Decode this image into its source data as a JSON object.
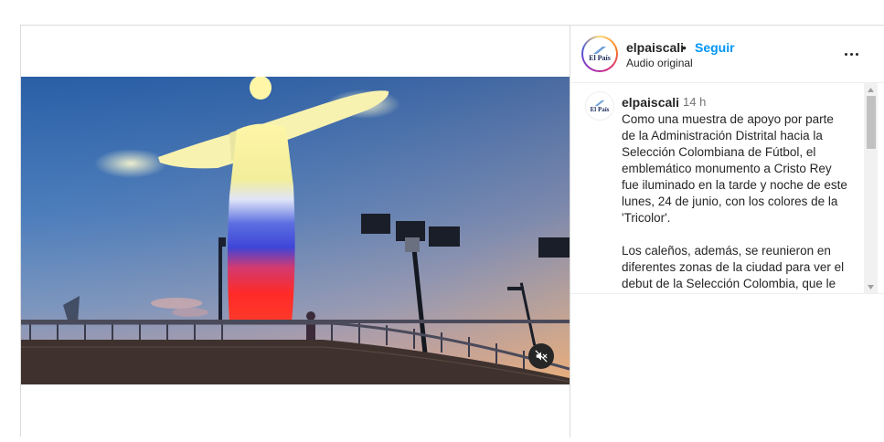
{
  "post": {
    "username": "elpaiscali",
    "separator": "•",
    "follow_label": "Seguir",
    "audio_label": "Audio original",
    "brand_logo_text": "El País"
  },
  "comment": {
    "username": "elpaiscali",
    "time": "14 h",
    "text": "Como una muestra de apoyo por parte de la Administración Distrital hacia la Selección Colombiana de Fútbol, el emblemático monumento a Cristo Rey fue iluminado en la tarde y noche de este lunes, 24 de junio, con los colores de la 'Tricolor'.\n\nLos caleños, además, se reunieron en diferentes zonas de la ciudad para ver el debut de la Selección Colombia, que le"
  },
  "icons": {
    "more": "more-options-icon",
    "mute": "volume-muted-icon",
    "scroll_up": "scroll-up-arrow-icon",
    "scroll_down": "scroll-down-arrow-icon"
  },
  "colors": {
    "follow": "#0095f6",
    "border": "#dbdbdb",
    "text": "#262626",
    "muted_text": "#737373"
  }
}
